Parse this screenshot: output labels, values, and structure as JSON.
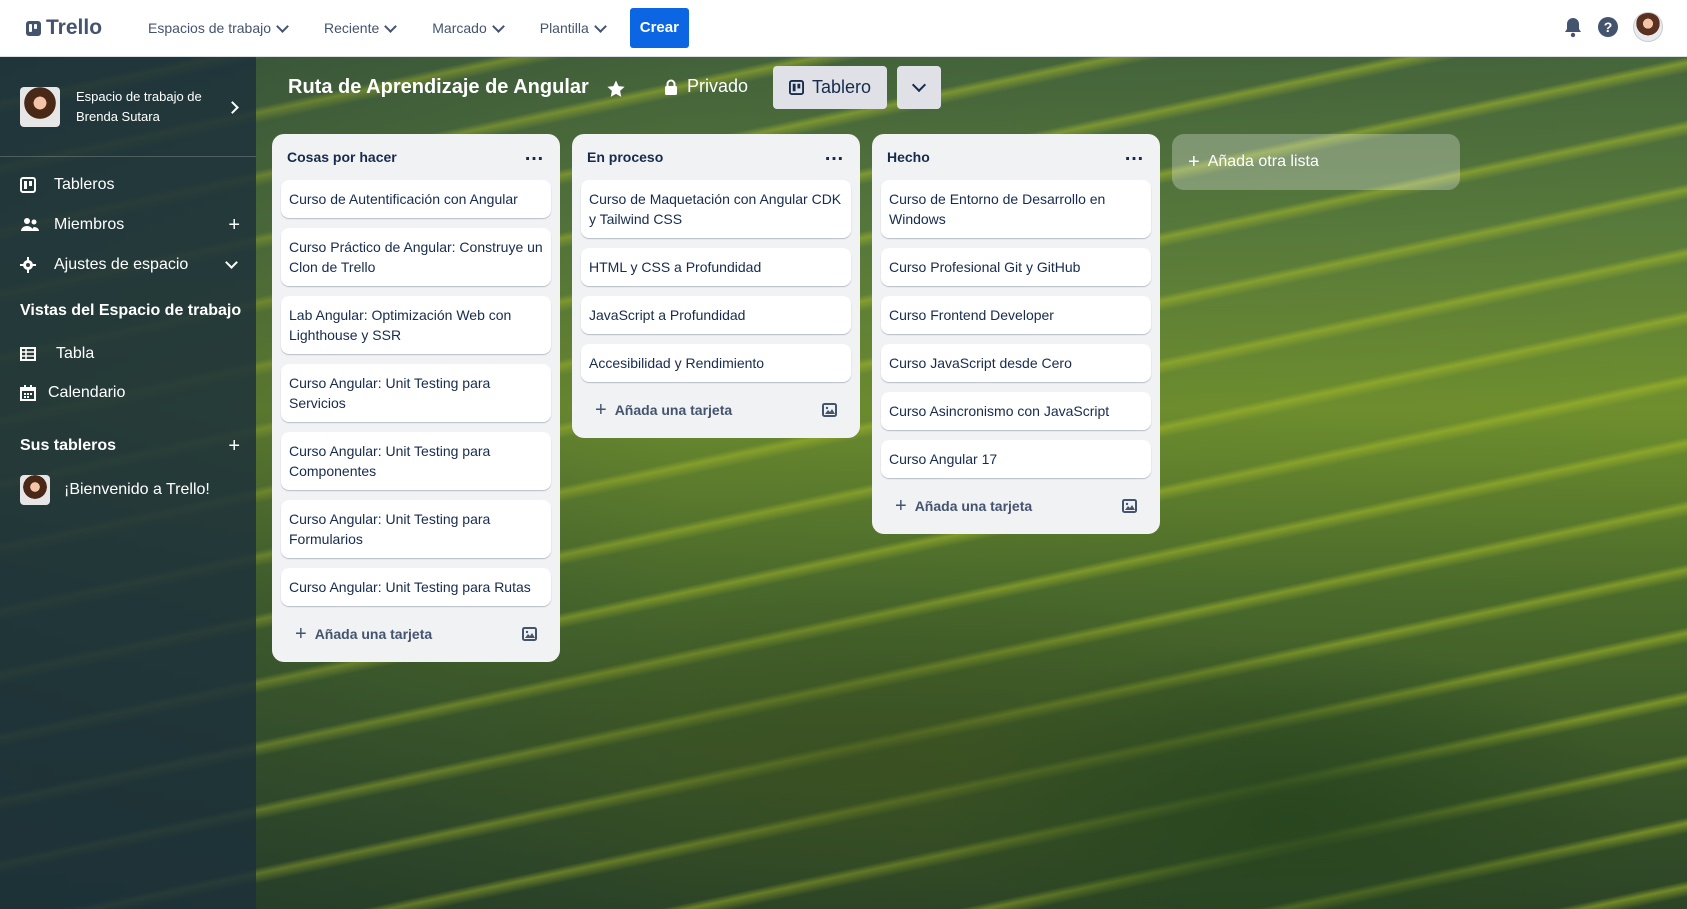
{
  "topbar": {
    "logo": "Trello",
    "nav": [
      {
        "label": "Espacios de trabajo"
      },
      {
        "label": "Reciente"
      },
      {
        "label": "Marcado"
      },
      {
        "label": "Plantilla"
      }
    ],
    "create_label": "Crear",
    "icons": [
      "bell-icon",
      "help-icon",
      "user-avatar"
    ]
  },
  "sidebar": {
    "workspace_name": "Espacio de trabajo de Brenda Sutara",
    "items": [
      {
        "label": "Tableros",
        "icon": "board-icon"
      },
      {
        "label": "Miembros",
        "icon": "members-icon"
      },
      {
        "label": "Ajustes de espacio",
        "icon": "gear-icon"
      }
    ],
    "views_title": "Vistas del Espacio de trabajo",
    "views": [
      {
        "label": "Tabla",
        "icon": "table-icon"
      },
      {
        "label": "Calendario",
        "icon": "calendar-icon"
      }
    ],
    "boards_title": "Sus tableros",
    "boards": [
      {
        "label": "¡Bienvenido a Trello!"
      }
    ]
  },
  "board": {
    "title": "Ruta de Aprendizaje de Angular",
    "privacy": "Privado",
    "view_label": "Tablero",
    "add_list_label": "Añada otra lista",
    "add_card_label": "Añada una tarjeta",
    "lists": [
      {
        "title": "Cosas por hacer",
        "cards": [
          "Curso de Autentificación con Angular",
          "Curso Práctico de Angular: Construye un Clon de Trello",
          "Lab Angular: Optimización Web con Lighthouse y SSR",
          "Curso Angular: Unit Testing para Servicios",
          "Curso Angular: Unit Testing para Componentes",
          "Curso Angular: Unit Testing para Formularios",
          "Curso Angular: Unit Testing para Rutas"
        ]
      },
      {
        "title": "En proceso",
        "cards": [
          "Curso de Maquetación con Angular CDK y Tailwind CSS",
          "HTML y CSS a Profundidad",
          "JavaScript a Profundidad",
          "Accesibilidad y Rendimiento"
        ]
      },
      {
        "title": "Hecho",
        "cards": [
          "Curso de Entorno de Desarrollo en Windows",
          "Curso Profesional Git y GitHub",
          "Curso Frontend Developer",
          "Curso JavaScript desde Cero",
          "Curso Asincronismo con JavaScript",
          "Curso Angular 17"
        ]
      }
    ]
  },
  "colors": {
    "create_button": "#0c66e4",
    "list_background": "#f1f2f4",
    "sidebar_background": "#1c303a"
  }
}
